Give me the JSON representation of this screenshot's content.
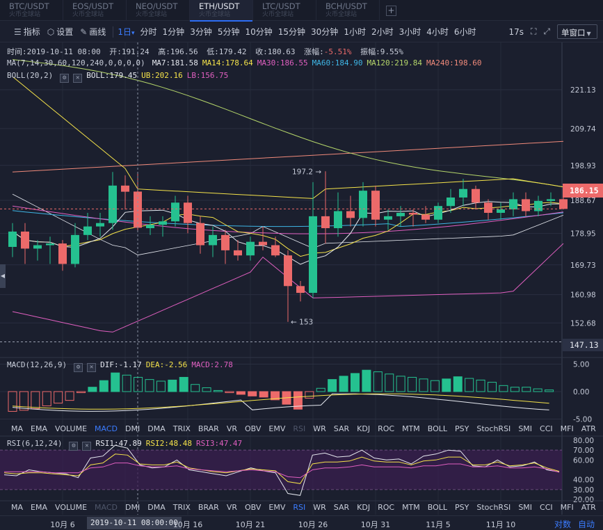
{
  "tabs": [
    {
      "name": "BTC/USDT",
      "sub": "火币全球站",
      "active": false
    },
    {
      "name": "EOS/USDT",
      "sub": "火币全球站",
      "active": false
    },
    {
      "name": "NEO/USDT",
      "sub": "火币全球站",
      "active": false
    },
    {
      "name": "ETH/USDT",
      "sub": "火币全球站",
      "active": true
    },
    {
      "name": "LTC/USDT",
      "sub": "火币全球站",
      "active": false
    },
    {
      "name": "BCH/USDT",
      "sub": "火币全球站",
      "active": false
    }
  ],
  "add_tab_label": "+",
  "toolbar": {
    "indicators": "指标",
    "settings": "设置",
    "draw": "画线",
    "selected_period": "1日",
    "periods": [
      "分时",
      "1分钟",
      "3分钟",
      "5分钟",
      "10分钟",
      "15分钟",
      "30分钟",
      "1小时",
      "2小时",
      "3小时",
      "4小时",
      "6小时"
    ],
    "interval_value": "17s",
    "window_mode": "单窗口"
  },
  "ohlc": {
    "time": "时间:2019-10-11 08:00",
    "open": "开:191.24",
    "high": "高:196.56",
    "low": "低:179.42",
    "close": "收:180.63",
    "change_label": "涨幅:",
    "change": "-5.51%",
    "amplitude": "振幅:9.55%"
  },
  "ma": {
    "title": "MA(7,14,30,60,120,240,0,0,0,0)",
    "items": [
      {
        "text": "MA7:181.58",
        "color": "#e6e9f0"
      },
      {
        "text": "MA14:178.64",
        "color": "#f5e34a"
      },
      {
        "text": "MA30:186.55",
        "color": "#e05fc0"
      },
      {
        "text": "MA60:184.90",
        "color": "#3fb6e6"
      },
      {
        "text": "MA120:219.84",
        "color": "#b5d66a"
      },
      {
        "text": "MA240:198.60",
        "color": "#f08a7a"
      }
    ]
  },
  "boll": {
    "title": "BOLL(20,2)",
    "items": [
      {
        "text": "BOLL:179.45",
        "color": "#e6e9f0"
      },
      {
        "text": "UB:202.16",
        "color": "#f5e34a"
      },
      {
        "text": "LB:156.75",
        "color": "#e05fc0"
      }
    ]
  },
  "macd": {
    "title": "MACD(12,26,9)",
    "items": [
      {
        "text": "DIF:-1.17",
        "color": "#e6e9f0"
      },
      {
        "text": "DEA:-2.56",
        "color": "#f5e34a"
      },
      {
        "text": "MACD:2.78",
        "color": "#e05fc0"
      }
    ]
  },
  "rsi": {
    "title": "RSI(6,12,24)",
    "items": [
      {
        "text": "RSI1:47.89",
        "color": "#e6e9f0"
      },
      {
        "text": "RSI2:48.48",
        "color": "#f5e34a"
      },
      {
        "text": "RSI3:47.47",
        "color": "#e05fc0"
      }
    ]
  },
  "indicator_tabs_macd": [
    {
      "label": "MA",
      "state": "normal"
    },
    {
      "label": "EMA",
      "state": "normal"
    },
    {
      "label": "VOLUME",
      "state": "normal"
    },
    {
      "label": "MACD",
      "state": "on"
    },
    {
      "label": "DMI",
      "state": "normal"
    },
    {
      "label": "DMA",
      "state": "normal"
    },
    {
      "label": "TRIX",
      "state": "normal"
    },
    {
      "label": "BRAR",
      "state": "normal"
    },
    {
      "label": "VR",
      "state": "normal"
    },
    {
      "label": "OBV",
      "state": "normal"
    },
    {
      "label": "EMV",
      "state": "normal"
    },
    {
      "label": "RSI",
      "state": "dim"
    },
    {
      "label": "WR",
      "state": "normal"
    },
    {
      "label": "SAR",
      "state": "normal"
    },
    {
      "label": "KDJ",
      "state": "normal"
    },
    {
      "label": "ROC",
      "state": "normal"
    },
    {
      "label": "MTM",
      "state": "normal"
    },
    {
      "label": "BOLL",
      "state": "normal"
    },
    {
      "label": "PSY",
      "state": "normal"
    },
    {
      "label": "StochRSI",
      "state": "normal"
    },
    {
      "label": "SMI",
      "state": "normal"
    },
    {
      "label": "CCI",
      "state": "normal"
    },
    {
      "label": "MFI",
      "state": "normal"
    },
    {
      "label": "ATR",
      "state": "normal"
    }
  ],
  "indicator_tabs_rsi": [
    {
      "label": "MA",
      "state": "normal"
    },
    {
      "label": "EMA",
      "state": "normal"
    },
    {
      "label": "VOLUME",
      "state": "normal"
    },
    {
      "label": "MACD",
      "state": "dim"
    },
    {
      "label": "DMI",
      "state": "normal"
    },
    {
      "label": "DMA",
      "state": "normal"
    },
    {
      "label": "TRIX",
      "state": "normal"
    },
    {
      "label": "BRAR",
      "state": "normal"
    },
    {
      "label": "VR",
      "state": "normal"
    },
    {
      "label": "OBV",
      "state": "normal"
    },
    {
      "label": "EMV",
      "state": "normal"
    },
    {
      "label": "RSI",
      "state": "on"
    },
    {
      "label": "WR",
      "state": "normal"
    },
    {
      "label": "SAR",
      "state": "normal"
    },
    {
      "label": "KDJ",
      "state": "normal"
    },
    {
      "label": "ROC",
      "state": "normal"
    },
    {
      "label": "MTM",
      "state": "normal"
    },
    {
      "label": "BOLL",
      "state": "normal"
    },
    {
      "label": "PSY",
      "state": "normal"
    },
    {
      "label": "StochRSI",
      "state": "normal"
    },
    {
      "label": "SMI",
      "state": "normal"
    },
    {
      "label": "CCI",
      "state": "normal"
    },
    {
      "label": "MFI",
      "state": "normal"
    },
    {
      "label": "ATR",
      "state": "normal"
    }
  ],
  "date_axis": {
    "labels": [
      "10月 6",
      "10月 16",
      "10月 21",
      "10月 26",
      "10月 31",
      "11月 5",
      "11月 10"
    ],
    "cursor_date": "2019-10-11 08:00:00",
    "log_btn": "对数",
    "auto_btn": "自动"
  },
  "colors": {
    "up": "#25c190",
    "down": "#ec6a6a",
    "accent": "#3b7cff",
    "background": "#1b1f2e"
  },
  "chart_data": [
    {
      "type": "candlestick",
      "title": "ETH/USDT 1日",
      "y_axis_ticks": [
        "221.13",
        "209.74",
        "198.93",
        "188.67",
        "178.95",
        "169.73",
        "160.98",
        "152.68"
      ],
      "current_price": "186.15",
      "low_line_label": "147.13",
      "annotations": [
        {
          "text": "197.2 →",
          "value": 197.2
        },
        {
          "text": "← 153",
          "value": 153
        }
      ],
      "candles": [
        {
          "o": 175,
          "h": 182,
          "l": 172,
          "c": 179.5
        },
        {
          "o": 179.5,
          "h": 182,
          "l": 170,
          "c": 174.5
        },
        {
          "o": 174.5,
          "h": 177,
          "l": 171,
          "c": 175.5
        },
        {
          "o": 175.5,
          "h": 178,
          "l": 170,
          "c": 176
        },
        {
          "o": 176,
          "h": 177,
          "l": 168,
          "c": 170
        },
        {
          "o": 170,
          "h": 182,
          "l": 169,
          "c": 178.5
        },
        {
          "o": 178.5,
          "h": 185,
          "l": 177,
          "c": 181
        },
        {
          "o": 181,
          "h": 185,
          "l": 178,
          "c": 182
        },
        {
          "o": 182,
          "h": 197,
          "l": 180,
          "c": 193
        },
        {
          "o": 193,
          "h": 196,
          "l": 186,
          "c": 191.2
        },
        {
          "o": 191.24,
          "h": 196.56,
          "l": 179.42,
          "c": 180.63
        },
        {
          "o": 180.5,
          "h": 184,
          "l": 178.5,
          "c": 181.5
        },
        {
          "o": 181.5,
          "h": 184,
          "l": 178,
          "c": 182.5
        },
        {
          "o": 182.5,
          "h": 190,
          "l": 181,
          "c": 188
        },
        {
          "o": 188,
          "h": 190,
          "l": 179,
          "c": 182
        },
        {
          "o": 182,
          "h": 184,
          "l": 173,
          "c": 175.5
        },
        {
          "o": 175.5,
          "h": 181,
          "l": 172,
          "c": 178.5
        },
        {
          "o": 178.5,
          "h": 180,
          "l": 170,
          "c": 174
        },
        {
          "o": 174,
          "h": 177,
          "l": 171,
          "c": 172.5
        },
        {
          "o": 172.5,
          "h": 178,
          "l": 171,
          "c": 176.5
        },
        {
          "o": 176.5,
          "h": 181,
          "l": 174,
          "c": 175.5
        },
        {
          "o": 175.5,
          "h": 178,
          "l": 172,
          "c": 172.5
        },
        {
          "o": 172.5,
          "h": 174,
          "l": 153,
          "c": 163.5
        },
        {
          "o": 163.5,
          "h": 165,
          "l": 159,
          "c": 161.5
        },
        {
          "o": 161.5,
          "h": 194,
          "l": 160,
          "c": 184
        },
        {
          "o": 184,
          "h": 197.2,
          "l": 176,
          "c": 180.5
        },
        {
          "o": 180.5,
          "h": 191,
          "l": 178,
          "c": 185.5
        },
        {
          "o": 185.5,
          "h": 190,
          "l": 181,
          "c": 183.5
        },
        {
          "o": 183.5,
          "h": 194,
          "l": 181,
          "c": 191.5
        },
        {
          "o": 191.5,
          "h": 193,
          "l": 181,
          "c": 183
        },
        {
          "o": 183,
          "h": 186,
          "l": 180,
          "c": 184
        },
        {
          "o": 184,
          "h": 187,
          "l": 181,
          "c": 185
        },
        {
          "o": 185,
          "h": 186,
          "l": 181,
          "c": 184.5
        },
        {
          "o": 184.5,
          "h": 187,
          "l": 182,
          "c": 183
        },
        {
          "o": 183,
          "h": 188,
          "l": 182,
          "c": 187
        },
        {
          "o": 187,
          "h": 192,
          "l": 185,
          "c": 189.5
        },
        {
          "o": 189.5,
          "h": 195,
          "l": 187,
          "c": 192
        },
        {
          "o": 192,
          "h": 193,
          "l": 186,
          "c": 188
        },
        {
          "o": 188,
          "h": 189,
          "l": 183,
          "c": 185
        },
        {
          "o": 185,
          "h": 188,
          "l": 183,
          "c": 186
        },
        {
          "o": 186,
          "h": 191,
          "l": 184,
          "c": 189
        },
        {
          "o": 189,
          "h": 191,
          "l": 184,
          "c": 185.5
        },
        {
          "o": 185.5,
          "h": 190,
          "l": 184,
          "c": 188.5
        },
        {
          "o": 188.5,
          "h": 191,
          "l": 187,
          "c": 189
        },
        {
          "o": 189,
          "h": 190,
          "l": 186,
          "c": 186.15
        }
      ]
    },
    {
      "type": "bar",
      "title": "MACD(12,26,9)",
      "y_axis_ticks": [
        "5.00",
        "0.00",
        "-5.00"
      ],
      "values": [
        -3.6,
        -3.4,
        -3.1,
        -2.6,
        -2.1,
        -1.6,
        -0.2,
        0.8,
        2.0,
        3.4,
        3.0,
        2.6,
        2.2,
        1.9,
        2.1,
        2.6,
        1.3,
        0.7,
        0.2,
        -0.2,
        -0.5,
        -0.8,
        -1.0,
        -1.5,
        -2.3,
        -3.2,
        -1.2,
        0.6,
        2.2,
        2.8,
        3.3,
        3.9,
        3.6,
        3.2,
        2.8,
        2.6,
        2.3,
        2.0,
        2.3,
        2.7,
        2.4,
        2.1,
        1.7,
        1.1,
        0.8,
        0.8,
        0.5,
        0.3
      ]
    },
    {
      "type": "line",
      "title": "RSI(6,12,24)",
      "y_axis_ticks": [
        "80.00",
        "70.00",
        "60.00",
        "40.00",
        "30.00",
        "20.00"
      ],
      "series": [
        {
          "name": "RSI1",
          "values": [
            45,
            44,
            50,
            48,
            47,
            46,
            42,
            62,
            64,
            75,
            72,
            55,
            52,
            53,
            60,
            50,
            48,
            46,
            44,
            48,
            52,
            49,
            47,
            26,
            24,
            65,
            67,
            63,
            64,
            70,
            62,
            60,
            61,
            56,
            64,
            66,
            70,
            69,
            54,
            53,
            60,
            53,
            54,
            58,
            50,
            47.9
          ]
        },
        {
          "name": "RSI2",
          "values": [
            47,
            46,
            47,
            47,
            46,
            45,
            44,
            55,
            57,
            66,
            65,
            56,
            55,
            55,
            58,
            52,
            50,
            48,
            47,
            49,
            51,
            50,
            49,
            38,
            36,
            56,
            58,
            58,
            59,
            63,
            59,
            58,
            58,
            55,
            59,
            60,
            63,
            63,
            55,
            55,
            58,
            54,
            55,
            57,
            52,
            48.5
          ]
        },
        {
          "name": "RSI3",
          "values": [
            48,
            48,
            48,
            48,
            47,
            47,
            47,
            52,
            53,
            57,
            57,
            54,
            53,
            53,
            54,
            51,
            50,
            49,
            48,
            49,
            50,
            49,
            48,
            43,
            42,
            50,
            52,
            52,
            53,
            55,
            53,
            53,
            53,
            52,
            54,
            54,
            56,
            56,
            53,
            53,
            54,
            52,
            52,
            53,
            51,
            47.5
          ]
        }
      ]
    }
  ]
}
